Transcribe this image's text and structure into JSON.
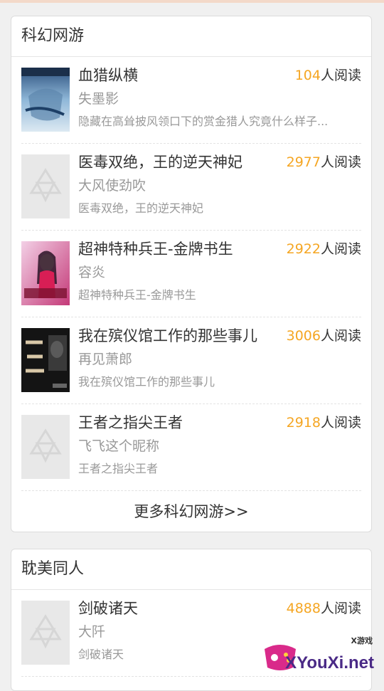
{
  "sections": [
    {
      "title": "科幻网游",
      "more_label": "更多科幻网游>>",
      "books": [
        {
          "title": "血猎纵横",
          "reads": "104",
          "reads_suffix": "人阅读",
          "author": "失墨影",
          "desc": "隐藏在高耸披风领口下的赏金猎人究竟什么样子...",
          "cover": "blue-art"
        },
        {
          "title": "医毒双绝，王的逆天神妃",
          "reads": "2977",
          "reads_suffix": "人阅读",
          "author": "大风使劲吹",
          "desc": "医毒双绝，王的逆天神妃",
          "cover": "placeholder"
        },
        {
          "title": "超神特种兵王-金牌书生",
          "reads": "2922",
          "reads_suffix": "人阅读",
          "author": "容炎",
          "desc": "超神特种兵王-金牌书生",
          "cover": "pink-art"
        },
        {
          "title": "我在殡仪馆工作的那些事儿",
          "reads": "3006",
          "reads_suffix": "人阅读",
          "author": "再见萧郎",
          "desc": "我在殡仪馆工作的那些事儿",
          "cover": "dark-art"
        },
        {
          "title": "王者之指尖王者",
          "reads": "2918",
          "reads_suffix": "人阅读",
          "author": "飞飞这个昵称",
          "desc": "王者之指尖王者",
          "cover": "placeholder"
        }
      ]
    },
    {
      "title": "耽美同人",
      "books": [
        {
          "title": "剑破诸天",
          "reads": "4888",
          "reads_suffix": "人阅读",
          "author": "大阡",
          "desc": "剑破诸天",
          "cover": "placeholder"
        }
      ]
    }
  ],
  "watermark": {
    "text": "XYouXi.net",
    "small": "X游戏"
  },
  "colors": {
    "accent": "#f5a623",
    "muted": "#999999",
    "border": "#dcdcdc"
  }
}
